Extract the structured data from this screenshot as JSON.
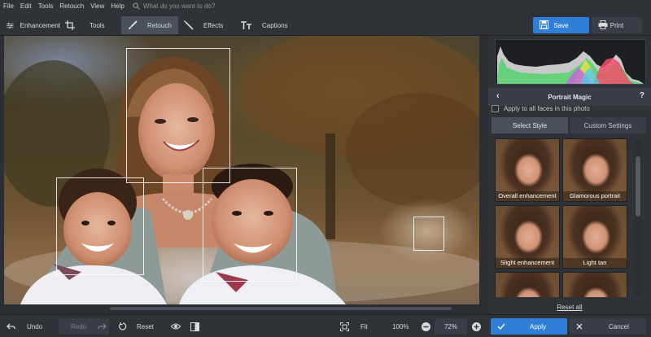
{
  "menu": {
    "items": [
      "File",
      "Edit",
      "Tools",
      "Retouch",
      "View",
      "Help"
    ],
    "search_placeholder": "What do you want to do?"
  },
  "toolbar": {
    "tabs": [
      {
        "label": "Enhancement",
        "icon": "sliders-icon"
      },
      {
        "label": "Tools",
        "icon": "crop-icon"
      },
      {
        "label": "Retouch",
        "icon": "brush-icon",
        "active": true
      },
      {
        "label": "Effects",
        "icon": "magic-wand-icon"
      },
      {
        "label": "Captions",
        "icon": "text-icon"
      }
    ],
    "save_label": "Save",
    "print_label": "Print"
  },
  "panel": {
    "title": "Portrait Magic",
    "apply_all_label": "Apply to all faces in this photo",
    "apply_all_checked": false,
    "tab_select": "Select Style",
    "tab_custom": "Custom Settings",
    "styles": [
      "Overall enhancement",
      "Glamorous portrait",
      "Slight enhancement",
      "Light tan",
      "",
      ""
    ],
    "reset_all": "Reset all"
  },
  "bottom": {
    "undo": "Undo",
    "redo": "Redo",
    "reset": "Reset",
    "fit": "Fit",
    "zoom_100": "100%",
    "zoom_level": "72%",
    "apply": "Apply",
    "cancel": "Cancel"
  },
  "colors": {
    "accent": "#2f7fd8",
    "background": "#2b2e33",
    "panel": "#2f3236"
  }
}
